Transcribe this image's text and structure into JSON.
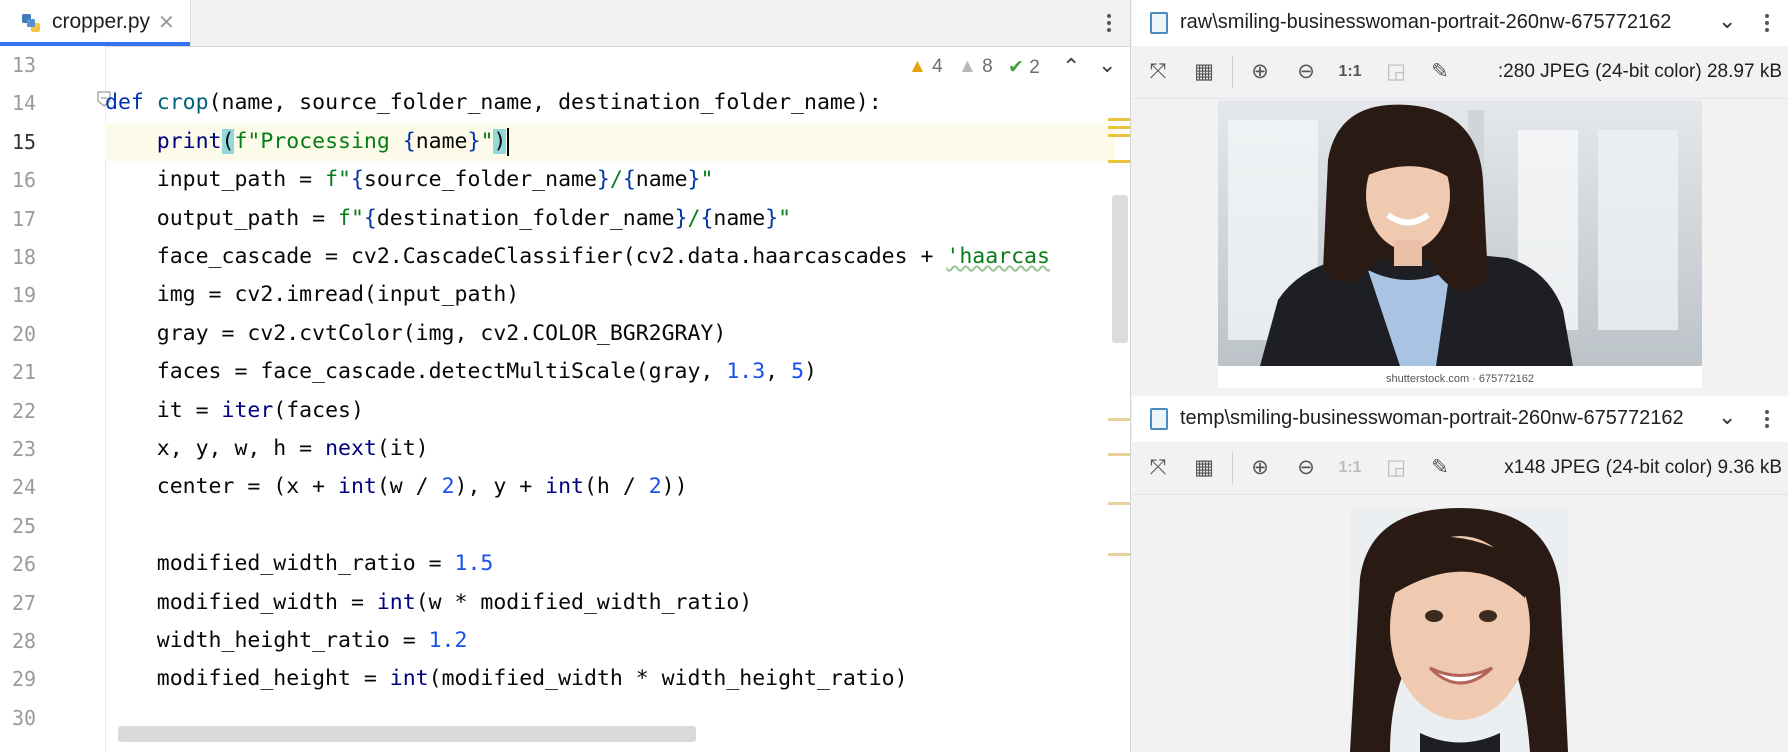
{
  "editor": {
    "tab": {
      "label": "cropper.py",
      "close": "✕"
    },
    "inspections": {
      "warnings_yellow": "4",
      "warnings_gray": "8",
      "ok": "2"
    },
    "lines": [
      {
        "n": "13"
      },
      {
        "n": "14"
      },
      {
        "n": "15"
      },
      {
        "n": "16"
      },
      {
        "n": "17"
      },
      {
        "n": "18"
      },
      {
        "n": "19"
      },
      {
        "n": "20"
      },
      {
        "n": "21"
      },
      {
        "n": "22"
      },
      {
        "n": "23"
      },
      {
        "n": "24"
      },
      {
        "n": "25"
      },
      {
        "n": "26"
      },
      {
        "n": "27"
      },
      {
        "n": "28"
      },
      {
        "n": "29"
      },
      {
        "n": "30"
      }
    ],
    "code": {
      "l14": {
        "kw": "def",
        "fn": "crop",
        "rest": "(name, source_folder_name, destination_folder_name):"
      },
      "l15": {
        "bi": "print",
        "open": "(",
        "str1": "f\"Processing ",
        "b1": "{",
        "var": "name",
        "b2": "}",
        "str2": "\"",
        "close": ")"
      },
      "l16": {
        "a": "input_path = ",
        "s1": "f\"",
        "b1": "{",
        "v1": "source_folder_name",
        "b2": "}",
        "s2": "/",
        "b3": "{",
        "v2": "name",
        "b4": "}",
        "s3": "\""
      },
      "l17": {
        "a": "output_path = ",
        "s1": "f\"",
        "b1": "{",
        "v1": "destination_folder_name",
        "b2": "}",
        "s2": "/",
        "b3": "{",
        "v2": "name",
        "b4": "}",
        "s3": "\""
      },
      "l18": {
        "a": "face_cascade = cv2.CascadeClassifier(cv2.data.haarcascades + ",
        "s": "'haarcas"
      },
      "l19": "img = cv2.imread(input_path)",
      "l20": "gray = cv2.cvtColor(img, cv2.COLOR_BGR2GRAY)",
      "l21": {
        "a": "faces = face_cascade.detectMultiScale(gray, ",
        "n1": "1.3",
        "c": ", ",
        "n2": "5",
        "e": ")"
      },
      "l22": {
        "a": "it = ",
        "bi": "iter",
        "e": "(faces)"
      },
      "l23": {
        "a": "x, y, w, h = ",
        "bi": "next",
        "e": "(it)"
      },
      "l24": {
        "a": "center = (x + ",
        "bi1": "int",
        "b": "(w / ",
        "n1": "2",
        "c": "), y + ",
        "bi2": "int",
        "d": "(h / ",
        "n2": "2",
        "e": "))"
      },
      "l26": {
        "a": "modified_width_ratio = ",
        "n": "1.5"
      },
      "l27": {
        "a": "modified_width = ",
        "bi": "int",
        "e": "(w * modified_width_ratio)"
      },
      "l28": {
        "a": "width_height_ratio = ",
        "n": "1.2"
      },
      "l29": {
        "a": "modified_height = ",
        "bi": "int",
        "e": "(modified_width * width_height_ratio)"
      }
    }
  },
  "viewer_top": {
    "title": "raw\\smiling-businesswoman-portrait-260nw-675772162",
    "info": ":280 JPEG (24-bit color) 28.97 kB",
    "watermark": "shutterstock.com · 675772162",
    "zoom_actual": "1:1"
  },
  "viewer_bottom": {
    "title": "temp\\smiling-businesswoman-portrait-260nw-675772162",
    "info": "x148 JPEG (24-bit color) 9.36 kB",
    "zoom_actual": "1:1"
  },
  "colors": {
    "accent": "#3574f0",
    "current_line": "#fcfae8",
    "keyword": "#0033b3",
    "string": "#067d17",
    "number": "#1750eb"
  }
}
